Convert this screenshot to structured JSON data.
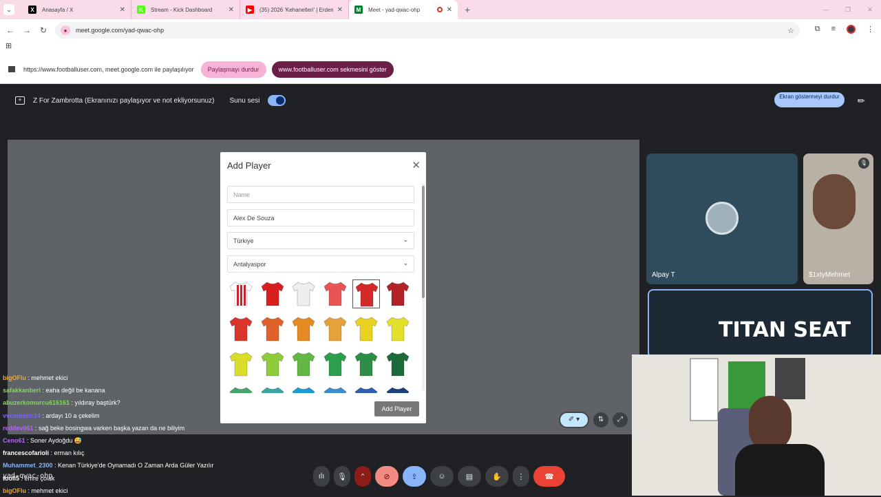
{
  "tabs": [
    {
      "title": "Anasayfa / X",
      "icon": "x-logo-icon",
      "color": "#000000",
      "glyph": "X"
    },
    {
      "title": "Stream - Kick Dashboard",
      "icon": "kick-logo-icon",
      "color": "#53fc18",
      "glyph": "K"
    },
    {
      "title": "(35) 2026 'Kehanetleri' | Erdem Ş...",
      "icon": "youtube-icon",
      "color": "#ff0000",
      "glyph": "▶"
    },
    {
      "title": "Meet - yad-qwac-ohp",
      "icon": "meet-icon",
      "color": "#00832d",
      "glyph": "M"
    }
  ],
  "url": "meet.google.com/yad-qwac-ohp",
  "sharebar": {
    "text": "https://www.footballuser.com, meet.google.com ile paylaşılıyor",
    "stop_label": "Paylaşmayı durdur",
    "show_label": "www.footballuser.com sekmesini göster"
  },
  "meet": {
    "presenter_text": "Z For Zambrotta (Ekranınızı paylaşıyor ve not ekliyorsunuz)",
    "sound_label": "Sunu sesi",
    "stop_show_label": "Ekran göstermeyi durdur",
    "code": "yad-qwac-ohp"
  },
  "modal": {
    "title": "Add Player",
    "name_placeholder": "Name",
    "fullname_value": "Alex De Souza",
    "country_value": "Türkiye",
    "club_value": "Antalyaspor",
    "add_button": "Add Player",
    "kits": [
      [
        "#ffffff|#d0202a",
        "#d81e1e",
        "#eeeeee",
        "#e95454",
        "#d42a2a",
        "#b22226"
      ],
      [
        "#d9352a",
        "#e0612a",
        "#e58a22",
        "#e6a23a",
        "#e9d21f",
        "#e3e02c"
      ],
      [
        "#d8de2a",
        "#8fcc3a",
        "#63b845",
        "#2e9e4c",
        "#2d8f45",
        "#1f6a3a"
      ],
      [
        "#46a66a",
        "#3aa7a0",
        "#1a9bd8",
        "#3d8ccf",
        "#2f5fb0",
        "#1a3f7d"
      ]
    ],
    "selected_kit": "0.4"
  },
  "participants": [
    {
      "name": "Alpay T"
    },
    {
      "name": "$1xtyMehmet"
    }
  ],
  "chat": [
    {
      "user": "bigOFlu",
      "color": "#f5a623",
      "text": " : mehmet ekici"
    },
    {
      "user": "safakkanberi",
      "color": "#7ed957",
      "text": " : eaha değil be kanana"
    },
    {
      "user": "abuzerkomurcu616161",
      "color": "#7ed957",
      "text": " : yıldıray baştürk?"
    },
    {
      "user": "vvcomonn14",
      "color": "#7b61ff",
      "text": " : ardayı 10 a çekelim"
    },
    {
      "user": "reddevil61",
      "color": "#b067f0",
      "text": " : sağ beke bosingwa varken başka yazan da ne biliyim"
    },
    {
      "user": "Ceno61",
      "color": "#b067f0",
      "text": " : Soner Aydoğdu 😅"
    },
    {
      "user": "francescofarioli",
      "color": "#ffffff",
      "text": " : erman kılıç"
    },
    {
      "user": "Muhammet_2300",
      "color": "#8ab4f8",
      "text": " : Kenan Türkiye'de Oynamadı O Zaman Arda Güler Yazılır"
    },
    {
      "user": "tooli5",
      "color": "#ffffff",
      "text": " : emre çolak"
    },
    {
      "user": "bigOFlu",
      "color": "#f5a623",
      "text": " : mehmet ekici"
    }
  ],
  "brand_banner": "TITAN SEAT"
}
